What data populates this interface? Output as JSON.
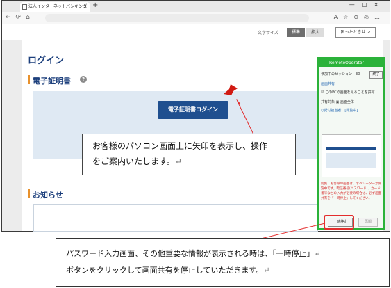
{
  "browser": {
    "tab_title": "法人インターネットバンキング",
    "tab_close": "×",
    "new_tab": "+",
    "window_controls": "—□×",
    "nav_icons": "←⟳⌂",
    "toolbar_icons": "A☆⊕◎…"
  },
  "util_bar": {
    "font_size_label": "文字サイズ",
    "standard_label": "標準",
    "large_label": "拡大",
    "help_label": "困ったときは ↗"
  },
  "page": {
    "title": "ログイン",
    "cert_section_title": "電子証明書",
    "help_icon": "?",
    "cert_login_button": "電子証明書ログイン",
    "notice_section_title": "お知らせ"
  },
  "remote_operator": {
    "title": "RemoteOperator",
    "minimize": "—",
    "session_label": "参加中のセッション",
    "session_count": "30",
    "end_button": "終了",
    "share_label": "画面共有",
    "allow_operate_label": "このPCの画面を見ることを許可",
    "target_label": "共有対象",
    "target_value": "画面全体",
    "operator_label": "○受付担当者　[閲覧中]",
    "warning_text": "閲覧、お客様の画面は、オペレーターが閲覧中です。暗証番号(パスワード)、カード番号などの入力が必要の場合は、必ず画面共有を「一時停止」してください。",
    "pause_button": "一時停止",
    "resume_button": "再開"
  },
  "annotations": {
    "callout1_line1": "お客様のパソコン画面上に矢印を表示し、操作",
    "callout1_line2": "をご案内いたします。",
    "callout2_line1": "パスワード入力画面、その他重要な情報が表示される時は、「一時停止」",
    "callout2_line2": "ボタンをクリックして画面共有を停止していただきます。",
    "return_mark": "↵"
  },
  "colors": {
    "brand_blue": "#1c3f7c",
    "button_blue": "#1f4f8f",
    "accent_orange": "#e8912c",
    "remote_green": "#2bb23a",
    "alert_red": "#e32d2d"
  }
}
